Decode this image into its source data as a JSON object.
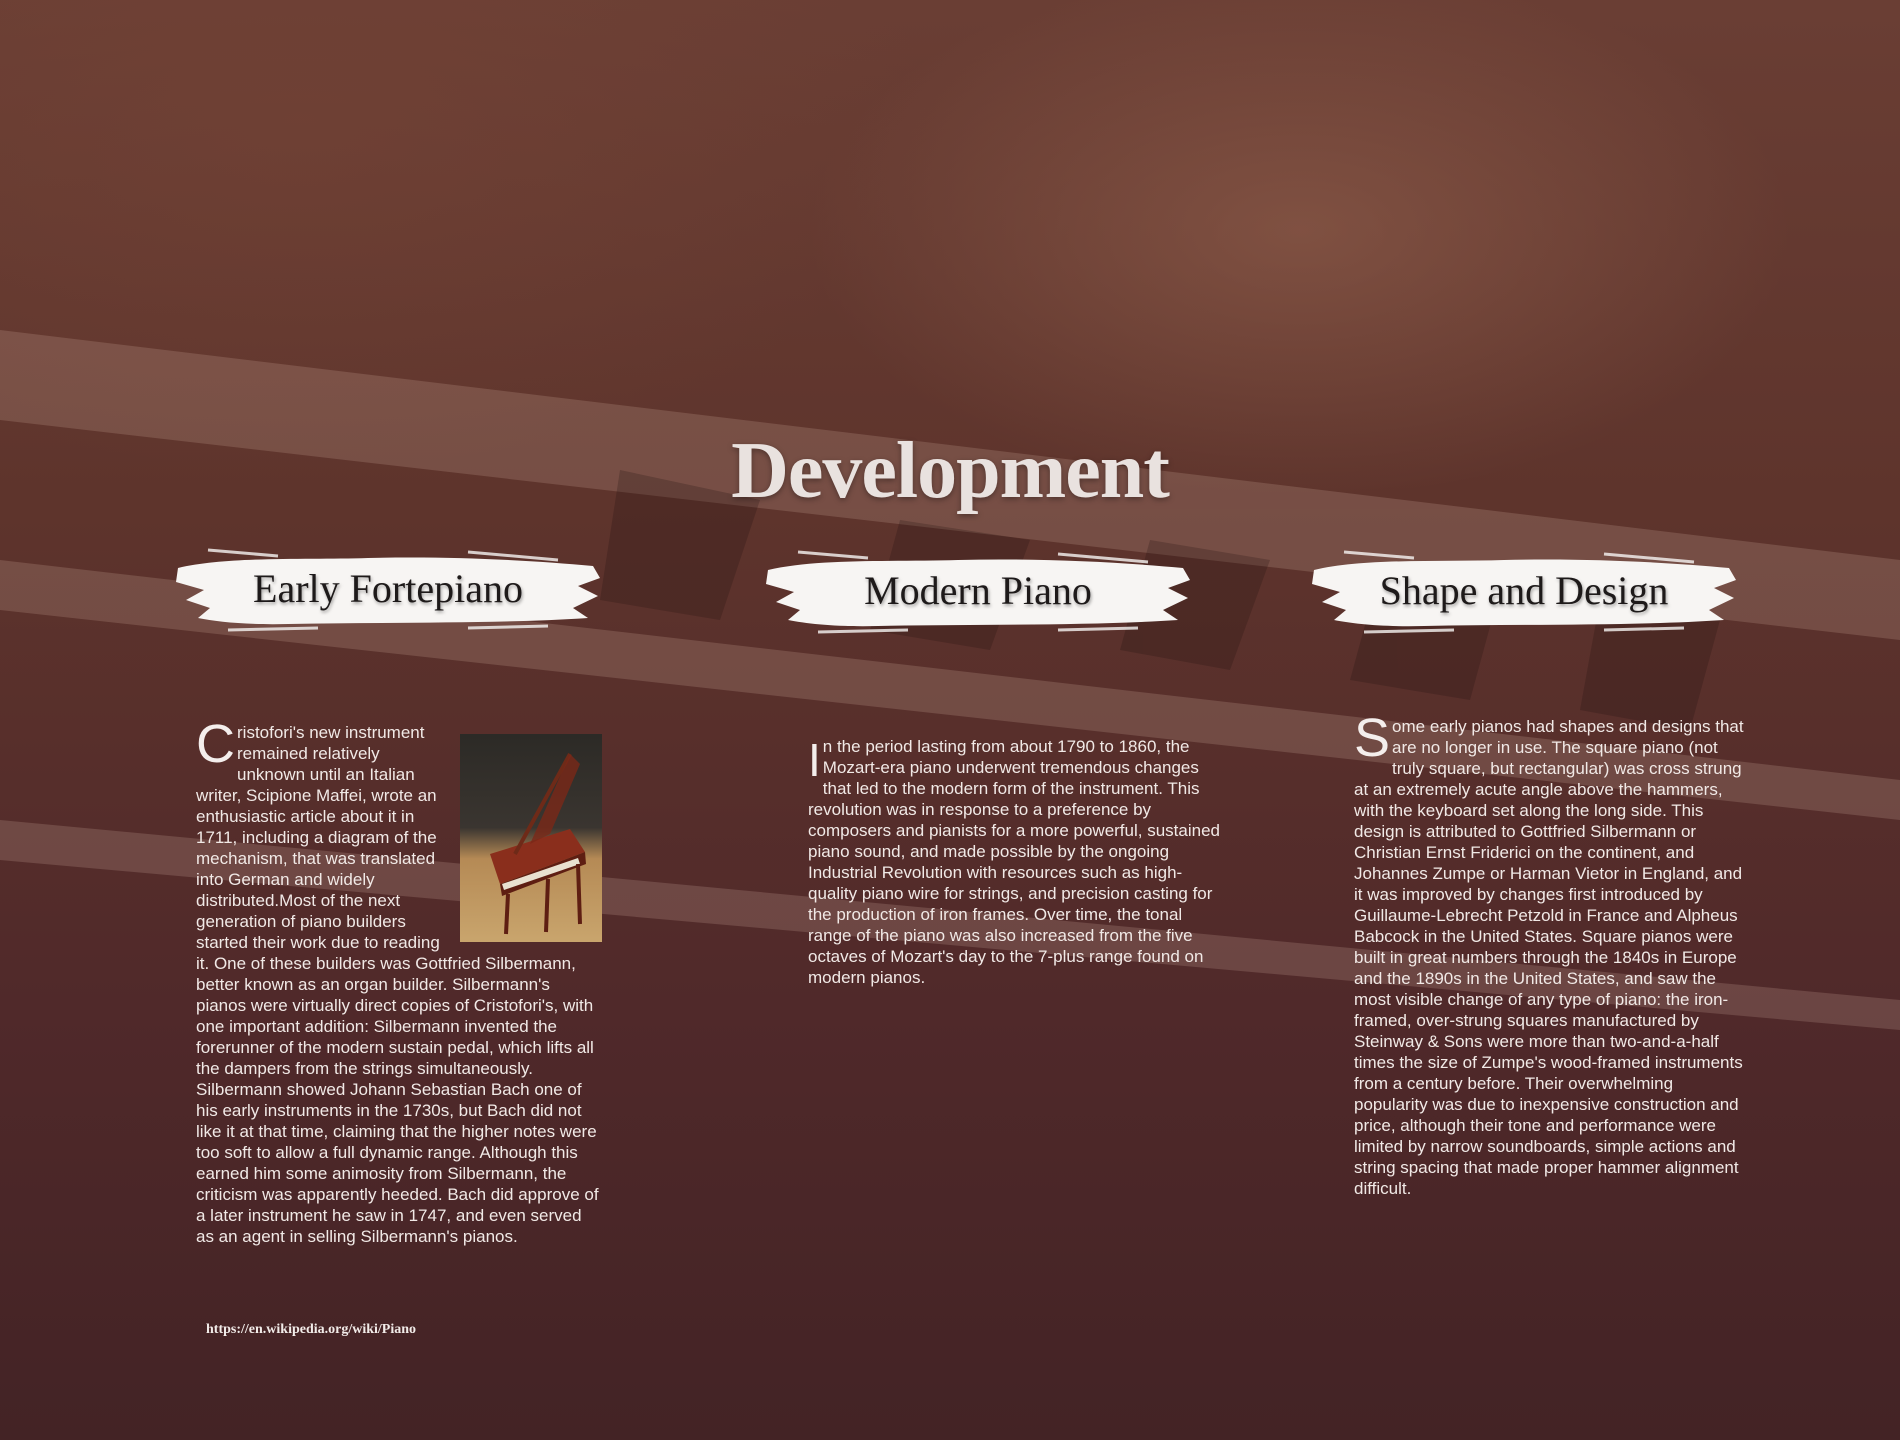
{
  "title": "Development",
  "sections": [
    {
      "heading": "Early Fortepiano",
      "dropcap": "C",
      "paragraphs": [
        "ristofori's new instrument remained relatively unknown until an Italian writer, Scipione Maffei, wrote an enthusiastic article about it in 1711, including a diagram of the mechanism, that was translated into German and widely distributed.Most of the next generation of piano builders started their work due to reading it. One of these builders was Gottfried Silbermann, better known as an organ builder. Silbermann's pianos were virtually direct copies of Cristofori's, with one important addition: Silbermann invented the forerunner of the modern sustain pedal, which lifts all the dampers from the strings simultaneously.",
        "Silbermann showed Johann Sebastian Bach one of his early instruments in the 1730s, but Bach did not like it at that time, claiming that the higher notes were too soft to allow a full dynamic range. Although this earned him some animosity from Silbermann, the criticism was apparently heeded. Bach did approve of a later instrument he saw in 1747, and even served as an agent in selling Silbermann's pianos."
      ],
      "image": "fortepiano-photo"
    },
    {
      "heading": "Modern Piano",
      "dropcap": "I",
      "paragraphs": [
        "n the period lasting from about 1790 to 1860, the Mozart-era piano underwent tremendous changes that led to the modern form of the instrument. This revolution was in response to a preference by composers and pianists for a more powerful, sustained piano sound, and made possible by the ongoing Industrial Revolution with resources such as high-quality piano wire for strings, and precision casting for the production of iron frames. Over time, the tonal range of the piano was also increased from the five octaves of Mozart's day to the 7-plus range found on modern pianos."
      ]
    },
    {
      "heading": "Shape and Design",
      "dropcap": "S",
      "paragraphs": [
        "ome early pianos had shapes and designs that are no longer in use. The square piano (not truly square, but rectangular) was cross strung at an extremely acute angle above the hammers, with the keyboard set along the long side. This design is attributed to Gottfried Silbermann or Christian Ernst Friderici on the continent, and Johannes Zumpe or Harman Vietor in England, and it was improved by changes first introduced by Guillaume-Lebrecht Petzold in France and Alpheus Babcock in the United States. Square pianos were built in great numbers through the 1840s in Europe and the 1890s in the United States, and saw the most visible change of any type of piano: the iron-framed, over-strung squares manufactured by Steinway & Sons were more than two-and-a-half times the size of Zumpe's wood-framed instruments from a century before. Their overwhelming popularity was due to inexpensive construction and price, although their tone and performance were limited by narrow soundboards, simple actions and string spacing that made proper hammer alignment difficult."
      ]
    }
  ],
  "source": "https://en.wikipedia.org/wiki/Piano"
}
